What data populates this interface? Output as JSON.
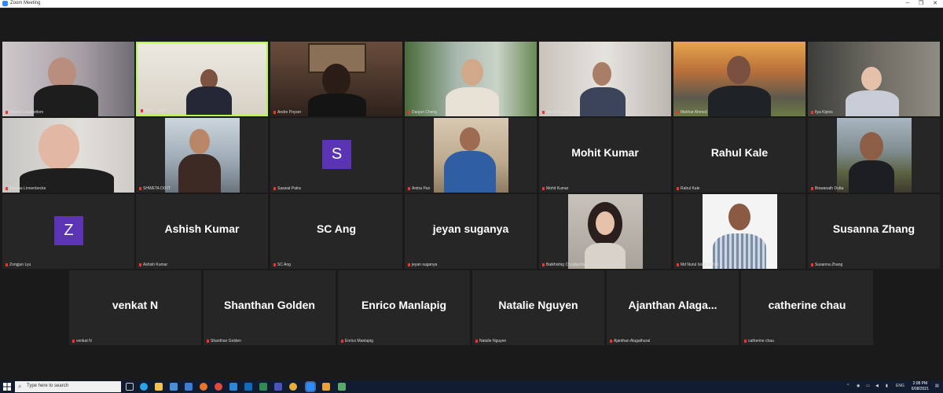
{
  "window": {
    "title": "Zoom Meeting",
    "min_label": "─",
    "max_label": "❐",
    "close_label": "✕"
  },
  "participants": [
    {
      "name": "Wayne Longbottom"
    },
    {
      "name": "Abhay Singh"
    },
    {
      "name": "Andre Poyser"
    },
    {
      "name": "Daojan Cheng"
    },
    {
      "name": "Tanvir Ahmed"
    },
    {
      "name": "Iftekhar Ahmed"
    },
    {
      "name": "Ilya Kipnis"
    },
    {
      "name": "Martina Linnenbecke"
    },
    {
      "name": "SHWETA DIXIT"
    },
    {
      "name": "Saswat Patra",
      "avatar_letter": "S"
    },
    {
      "name": "Anitra Pan"
    },
    {
      "name": "Mohit Kumar"
    },
    {
      "name": "Rahul Kale"
    },
    {
      "name": "Biswanath Dutta"
    },
    {
      "name": "Zongjun Lyu",
      "avatar_letter": "Z"
    },
    {
      "name": "Ashish Kumar"
    },
    {
      "name": "SC Ang"
    },
    {
      "name": "jeyan suganya"
    },
    {
      "name": "Batkhishig Choijiljamba"
    },
    {
      "name": "Md Nurul Islam Sohel"
    },
    {
      "name": "Susanna Zhang"
    },
    {
      "name": "venkat N"
    },
    {
      "name": "Shanthan Golden"
    },
    {
      "name": "Enrico Manlapig"
    },
    {
      "name": "Natalie Nguyen"
    },
    {
      "name": "Ajanthan Alagathurai",
      "display_name": "Ajanthan  Alaga..."
    },
    {
      "name": "catherine chau"
    }
  ],
  "taskbar": {
    "search_placeholder": "Type here to search",
    "language": "ENG",
    "time": "2:08 PM",
    "date": "6/08/2021"
  },
  "colors": {
    "active_speaker_border": "#b5f84a",
    "avatar_bg": "#5a34b5",
    "tile_bg": "#262626",
    "stage_bg": "#1a1a1a"
  }
}
